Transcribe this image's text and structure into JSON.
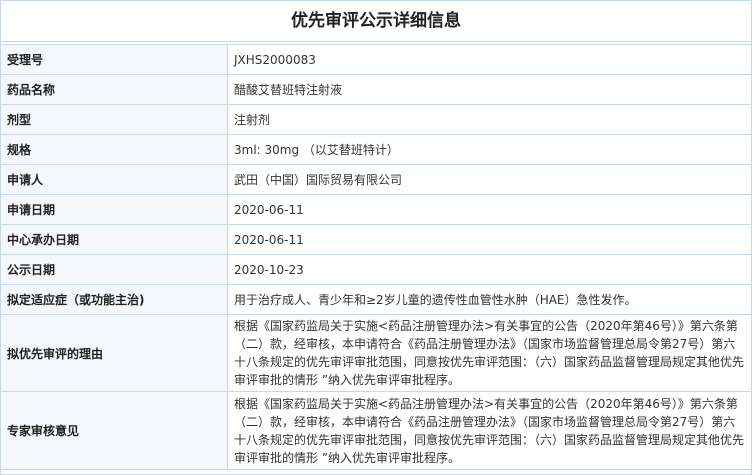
{
  "page": {
    "title": "优先审评公示详细信息"
  },
  "rows": [
    {
      "label": "受理号",
      "value": "JXHS2000083"
    },
    {
      "label": "药品名称",
      "value": "醋酸艾替班特注射液"
    },
    {
      "label": "剂型",
      "value": "注射剂"
    },
    {
      "label": "规格",
      "value": "3ml: 30mg （以艾替班特计）"
    },
    {
      "label": "申请人",
      "value": "武田（中国）国际贸易有限公司"
    },
    {
      "label": "申请日期",
      "value": "2020-06-11"
    },
    {
      "label": "中心承办日期",
      "value": "2020-06-11"
    },
    {
      "label": "公示日期",
      "value": "2020-10-23"
    },
    {
      "label": "拟定适应症（或功能主治)",
      "value": "用于治疗成人、青少年和≥2岁儿童的遗传性血管性水肿（HAE）急性发作。"
    },
    {
      "label": "拟优先审评的理由",
      "value": "根据《国家药监局关于实施<药品注册管理办法>有关事宜的公告（2020年第46号）》第六条第（二）款，经审核，本申请符合《药品注册管理办法》（国家市场监督管理总局令第27号）第六十八条规定的优先审评审批范围，同意按优先审评范围：（六）国家药品监督管理局规定其他优先审评审批的情形 ”纳入优先审评审批程序。"
    },
    {
      "label": "专家审核意见",
      "value": "根据《国家药监局关于实施<药品注册管理办法>有关事宜的公告（2020年第46号）》第六条第（二）款，经审核，本申请符合《药品注册管理办法》（国家市场监督管理总局令第27号）第六十八条规定的优先审评审批范围，同意按优先审评范围：（六）国家药品监督管理局规定其他优先审评审批的情形 ”纳入优先审评审批程序。"
    }
  ]
}
